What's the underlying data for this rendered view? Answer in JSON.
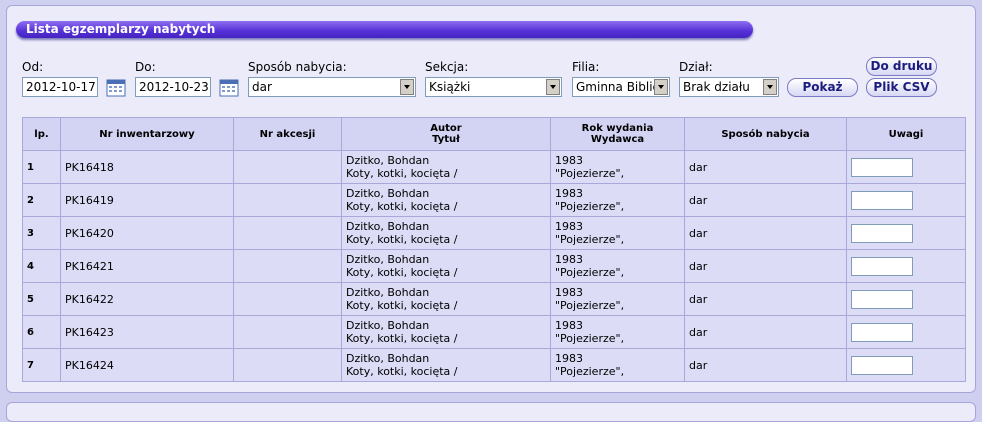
{
  "panel": {
    "title": "Lista egzemplarzy nabytych"
  },
  "filters": {
    "from_label": "Od:",
    "from_value": "2012-10-17",
    "to_label": "Do:",
    "to_value": "2012-10-23",
    "acquisition_label": "Sposób nabycia:",
    "acquisition_value": "dar",
    "section_label": "Sekcja:",
    "section_value": "Książki",
    "branch_label": "Filia:",
    "branch_value": "Gminna Biblic",
    "department_label": "Dział:",
    "department_value": "Brak działu",
    "show_button": "Pokaż",
    "print_button": "Do druku",
    "csv_button": "Plik CSV"
  },
  "table": {
    "headers": {
      "lp": "lp.",
      "inventory": "Nr inwentarzowy",
      "accession": "Nr akcesji",
      "author_line1": "Autor",
      "author_line2": "Tytuł",
      "year_line1": "Rok wydania",
      "year_line2": "Wydawca",
      "acquisition": "Sposób nabycia",
      "notes": "Uwagi"
    },
    "rows": [
      {
        "lp": "1",
        "inventory": "PK16418",
        "accession": "",
        "author": "Dzitko, Bohdan",
        "title": "Koty, kotki, kocięta /",
        "year": "1983",
        "publisher": "\"Pojezierze\",",
        "acquisition": "dar"
      },
      {
        "lp": "2",
        "inventory": "PK16419",
        "accession": "",
        "author": "Dzitko, Bohdan",
        "title": "Koty, kotki, kocięta /",
        "year": "1983",
        "publisher": "\"Pojezierze\",",
        "acquisition": "dar"
      },
      {
        "lp": "3",
        "inventory": "PK16420",
        "accession": "",
        "author": "Dzitko, Bohdan",
        "title": "Koty, kotki, kocięta /",
        "year": "1983",
        "publisher": "\"Pojezierze\",",
        "acquisition": "dar"
      },
      {
        "lp": "4",
        "inventory": "PK16421",
        "accession": "",
        "author": "Dzitko, Bohdan",
        "title": "Koty, kotki, kocięta /",
        "year": "1983",
        "publisher": "\"Pojezierze\",",
        "acquisition": "dar"
      },
      {
        "lp": "5",
        "inventory": "PK16422",
        "accession": "",
        "author": "Dzitko, Bohdan",
        "title": "Koty, kotki, kocięta /",
        "year": "1983",
        "publisher": "\"Pojezierze\",",
        "acquisition": "dar"
      },
      {
        "lp": "6",
        "inventory": "PK16423",
        "accession": "",
        "author": "Dzitko, Bohdan",
        "title": "Koty, kotki, kocięta /",
        "year": "1983",
        "publisher": "\"Pojezierze\",",
        "acquisition": "dar"
      },
      {
        "lp": "7",
        "inventory": "PK16424",
        "accession": "",
        "author": "Dzitko, Bohdan",
        "title": "Koty, kotki, kocięta /",
        "year": "1983",
        "publisher": "\"Pojezierze\",",
        "acquisition": "dar"
      }
    ]
  },
  "colors": {
    "background": "#cfd0ef",
    "panel": "#ebebf9",
    "title_bar": "#5430d6",
    "button_text": "#1c1c7e"
  },
  "icons": {
    "calendar": "calendar-icon",
    "dropdown": "chevron-down-icon"
  }
}
